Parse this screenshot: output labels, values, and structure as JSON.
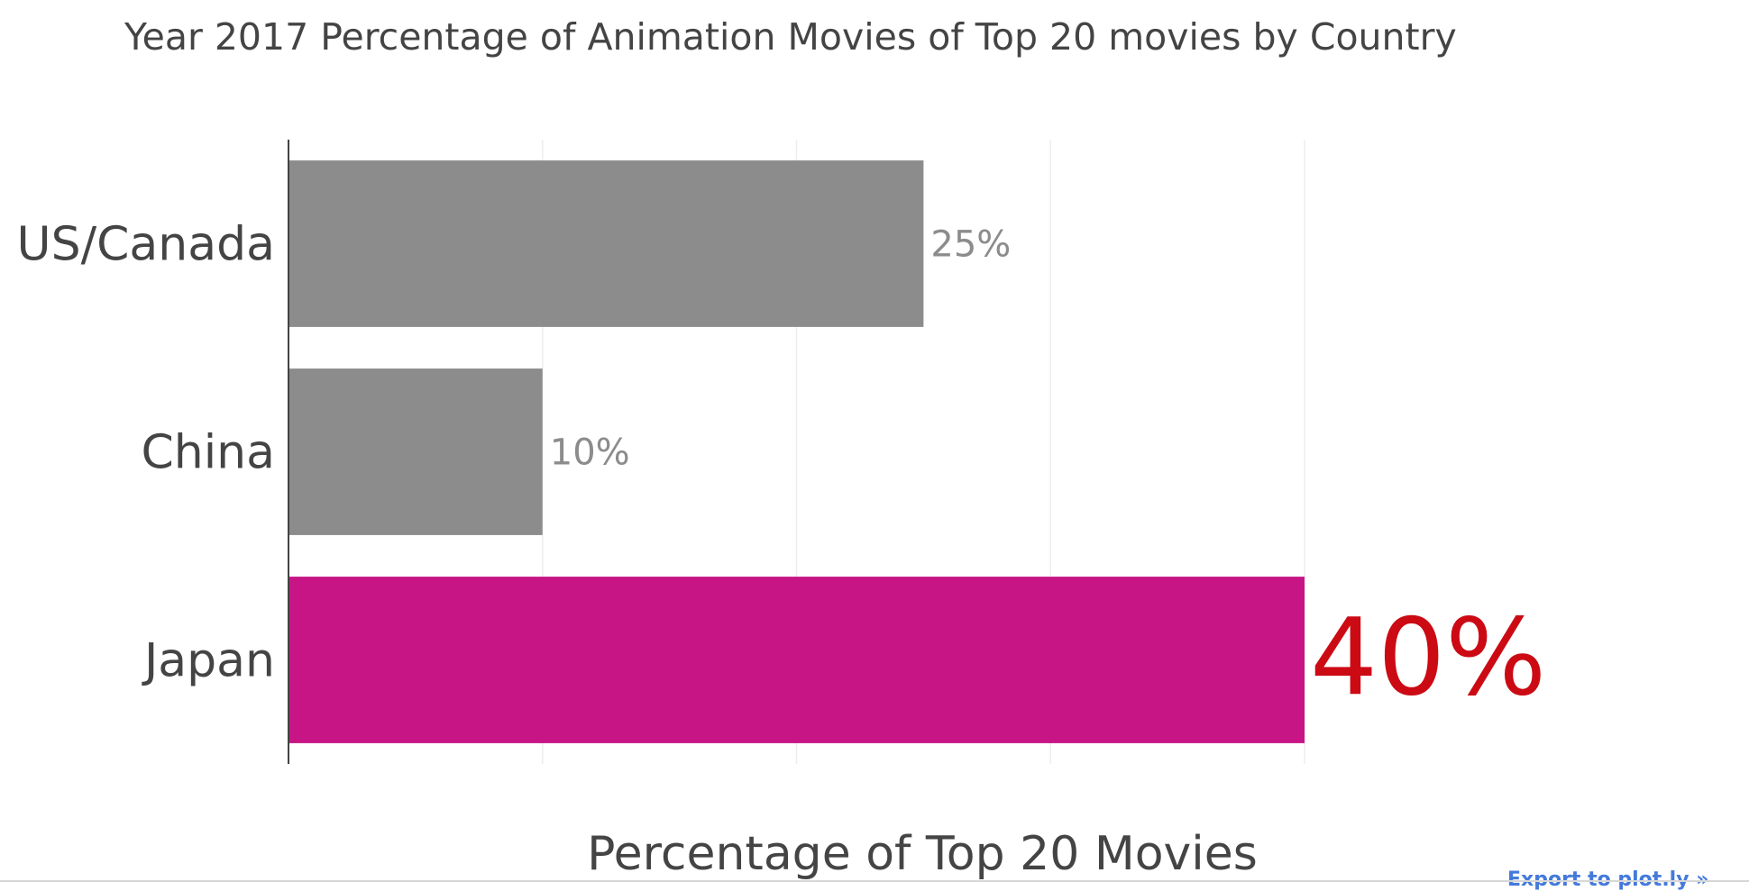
{
  "chart_data": {
    "type": "bar",
    "orientation": "horizontal",
    "title": "Year 2017 Percentage of Animation Movies of Top 20 movies by Country",
    "xlabel": "Percentage of Top 20 Movies",
    "ylabel": "",
    "categories": [
      "US/Canada",
      "China",
      "Japan"
    ],
    "values": [
      25,
      10,
      40
    ],
    "value_labels": [
      "25%",
      "10%",
      "40%"
    ],
    "xlim": [
      0,
      40
    ],
    "x_gridlines": [
      10,
      20,
      30,
      40
    ],
    "grid": "vertical",
    "bar_colors": [
      "#8c8c8c",
      "#8c8c8c",
      "#c71585"
    ],
    "value_label_colors": [
      "#8c8c8c",
      "#8c8c8c",
      "#cc0a14"
    ],
    "highlight_category": "Japan"
  },
  "footer": {
    "export_link": "Export to plot.ly »"
  }
}
